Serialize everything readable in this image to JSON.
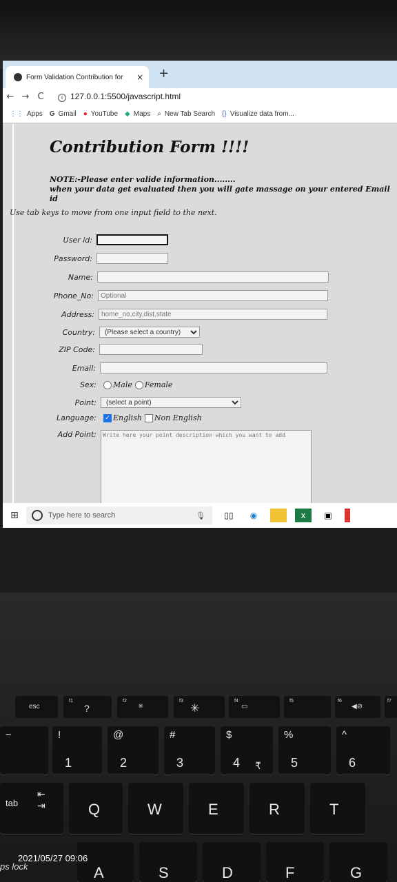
{
  "browser": {
    "tab_title": "Form Validation Contribution for",
    "tab_close": "×",
    "new_tab": "+",
    "url": "127.0.0.1:5500/javascript.html",
    "bookmarks": [
      "Apps",
      "Gmail",
      "YouTube",
      "Maps",
      "New Tab Search",
      "Visualize data from..."
    ]
  },
  "form": {
    "title": "Contribution Form !!!!",
    "note_line1": "NOTE:-Please enter valide information........",
    "note_line2": "when your data get evaluated then you will gate massage on your entered Email id",
    "hint": "Use tab keys to move from one input field to the next.",
    "labels": {
      "user_id": "User id:",
      "password": "Password:",
      "name": "Name:",
      "phone": "Phone_No:",
      "address": "Address:",
      "country": "Country:",
      "zip": "ZIP Code:",
      "email": "Email:",
      "sex": "Sex:",
      "point": "Point:",
      "language": "Language:",
      "add_point": "Add Point:"
    },
    "placeholders": {
      "phone": "Optional",
      "address": "home_no,city,dist,state",
      "add_point": "Write here your point description which you want to add"
    },
    "country_selected": "(Please select a country)",
    "point_selected": "(select a point)",
    "sex_options": [
      "Male",
      "Female"
    ],
    "language_options": [
      "English",
      "Non English"
    ]
  },
  "taskbar": {
    "search_placeholder": "Type here to search"
  },
  "keyboard": {
    "fn_keys": [
      "esc",
      "f1",
      "f2",
      "f3",
      "f4",
      "f5",
      "f6",
      "f7"
    ],
    "number_keys": [
      {
        "top": "!",
        "bottom": "1"
      },
      {
        "top": "@",
        "bottom": "2"
      },
      {
        "top": "#",
        "bottom": "3"
      },
      {
        "top": "$",
        "bottom": "4"
      },
      {
        "top": "%",
        "bottom": "5"
      },
      {
        "top": "^",
        "bottom": "6"
      }
    ],
    "letter_row1": [
      "Q",
      "W",
      "E",
      "R",
      "T"
    ],
    "letter_row2": [
      "A",
      "S",
      "D",
      "F",
      "G"
    ],
    "tab_label": "tab",
    "caps_label": "ps lock"
  },
  "timestamp": "2021/05/27 09:06"
}
